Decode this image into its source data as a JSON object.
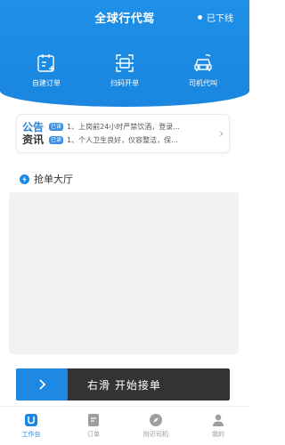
{
  "header": {
    "title": "全球行代驾",
    "status": "已下线"
  },
  "quick_actions": [
    {
      "label": "自建订单",
      "icon": "calendar-add-icon"
    },
    {
      "label": "扫码开单",
      "icon": "scan-icon"
    },
    {
      "label": "司机代叫",
      "icon": "car-icon"
    }
  ],
  "notice": {
    "title_line1": "公告",
    "title_line2": "资讯",
    "items": [
      {
        "badge": "已读",
        "text": "1、上岗前24小时严禁饮酒，登录..."
      },
      {
        "badge": "已读",
        "text": "1、个人卫生良好，仪容整洁，保..."
      }
    ]
  },
  "section": {
    "title": "抢单大厅"
  },
  "slider": {
    "label": "右滑 开始接单"
  },
  "bottom_nav": [
    {
      "label": "工作台",
      "icon": "workbench-icon",
      "active": true
    },
    {
      "label": "订单",
      "icon": "order-icon",
      "active": false
    },
    {
      "label": "附近司机",
      "icon": "compass-icon",
      "active": false
    },
    {
      "label": "我的",
      "icon": "user-icon",
      "active": false
    }
  ],
  "colors": {
    "primary": "#1e88e5",
    "slider_bg": "#333333",
    "panel_bg": "#f2f2f2"
  }
}
